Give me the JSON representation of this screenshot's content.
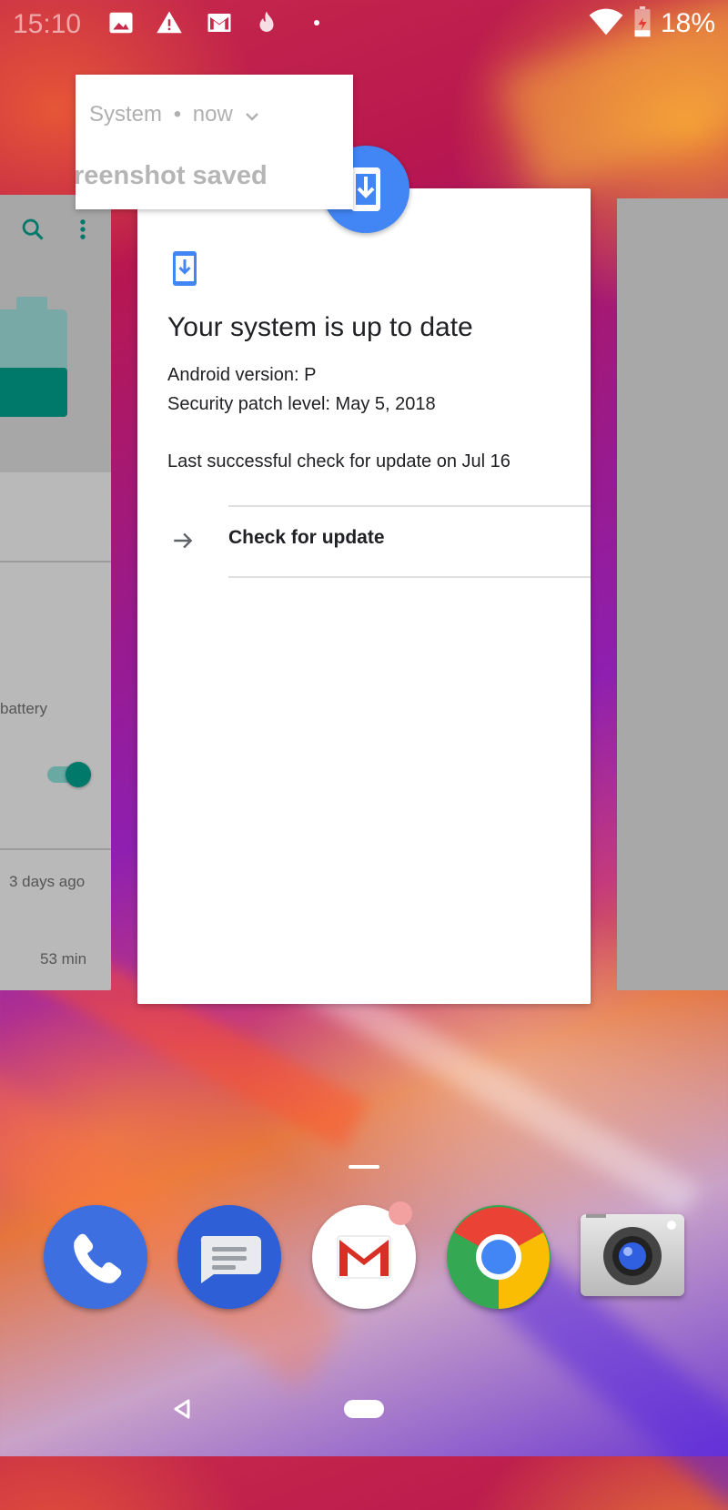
{
  "status_bar": {
    "time": "15:10",
    "battery_percent": "18%",
    "icons": [
      "image-icon",
      "warning-icon",
      "gmail-icon",
      "fire-icon",
      "dot-icon",
      "wifi-icon",
      "battery-charging-icon"
    ]
  },
  "notification": {
    "app": "System",
    "separator": "•",
    "when": "now",
    "body": "reenshot saved"
  },
  "left_card": {
    "text_battery": "battery",
    "text_days": "3 days ago",
    "text_min": "53 min",
    "toggle_on": true,
    "accent": "#00796b"
  },
  "main_card": {
    "title": "Your system is up to date",
    "android_version": "Android version: P",
    "security_patch": "Security patch level: May 5, 2018",
    "last_check": "Last successful check for update on Jul 16",
    "check_button": "Check for update",
    "accent": "#4285f4"
  },
  "dock": {
    "apps": [
      "phone-icon",
      "messages-icon",
      "gmail-icon",
      "chrome-icon",
      "camera-icon"
    ]
  },
  "nav": {
    "buttons": [
      "back-button",
      "home-button"
    ]
  }
}
